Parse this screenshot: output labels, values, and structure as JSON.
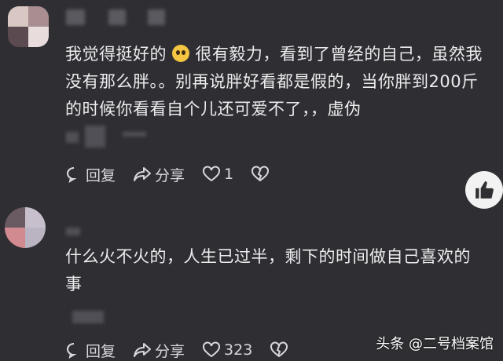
{
  "comments": [
    {
      "text_line1": "我觉得挺好的",
      "text_line1_b": " 很有毅力，看到了曾经的自己，虽然我",
      "text_line2": "没有那么胖。。别再说胖好看都是假的，当你胖到200斤",
      "text_line3": "的时候你看看自个儿还可爱不了，，虚伪",
      "reply_label": "回复",
      "share_label": "分享",
      "like_count": "1"
    },
    {
      "text_line1": "什么火不火的，人生已过半，剩下的时间做自己喜欢的",
      "text_line2": "事",
      "reply_label": "回复",
      "share_label": "分享",
      "like_count": "323"
    }
  ],
  "watermark": "头条 @二号档案馆",
  "icons": {
    "reply": "comment-bubble-icon",
    "share": "share-arrow-icon",
    "like": "heart-icon",
    "dislike": "broken-heart-icon",
    "thumb": "thumbs-up-icon"
  }
}
